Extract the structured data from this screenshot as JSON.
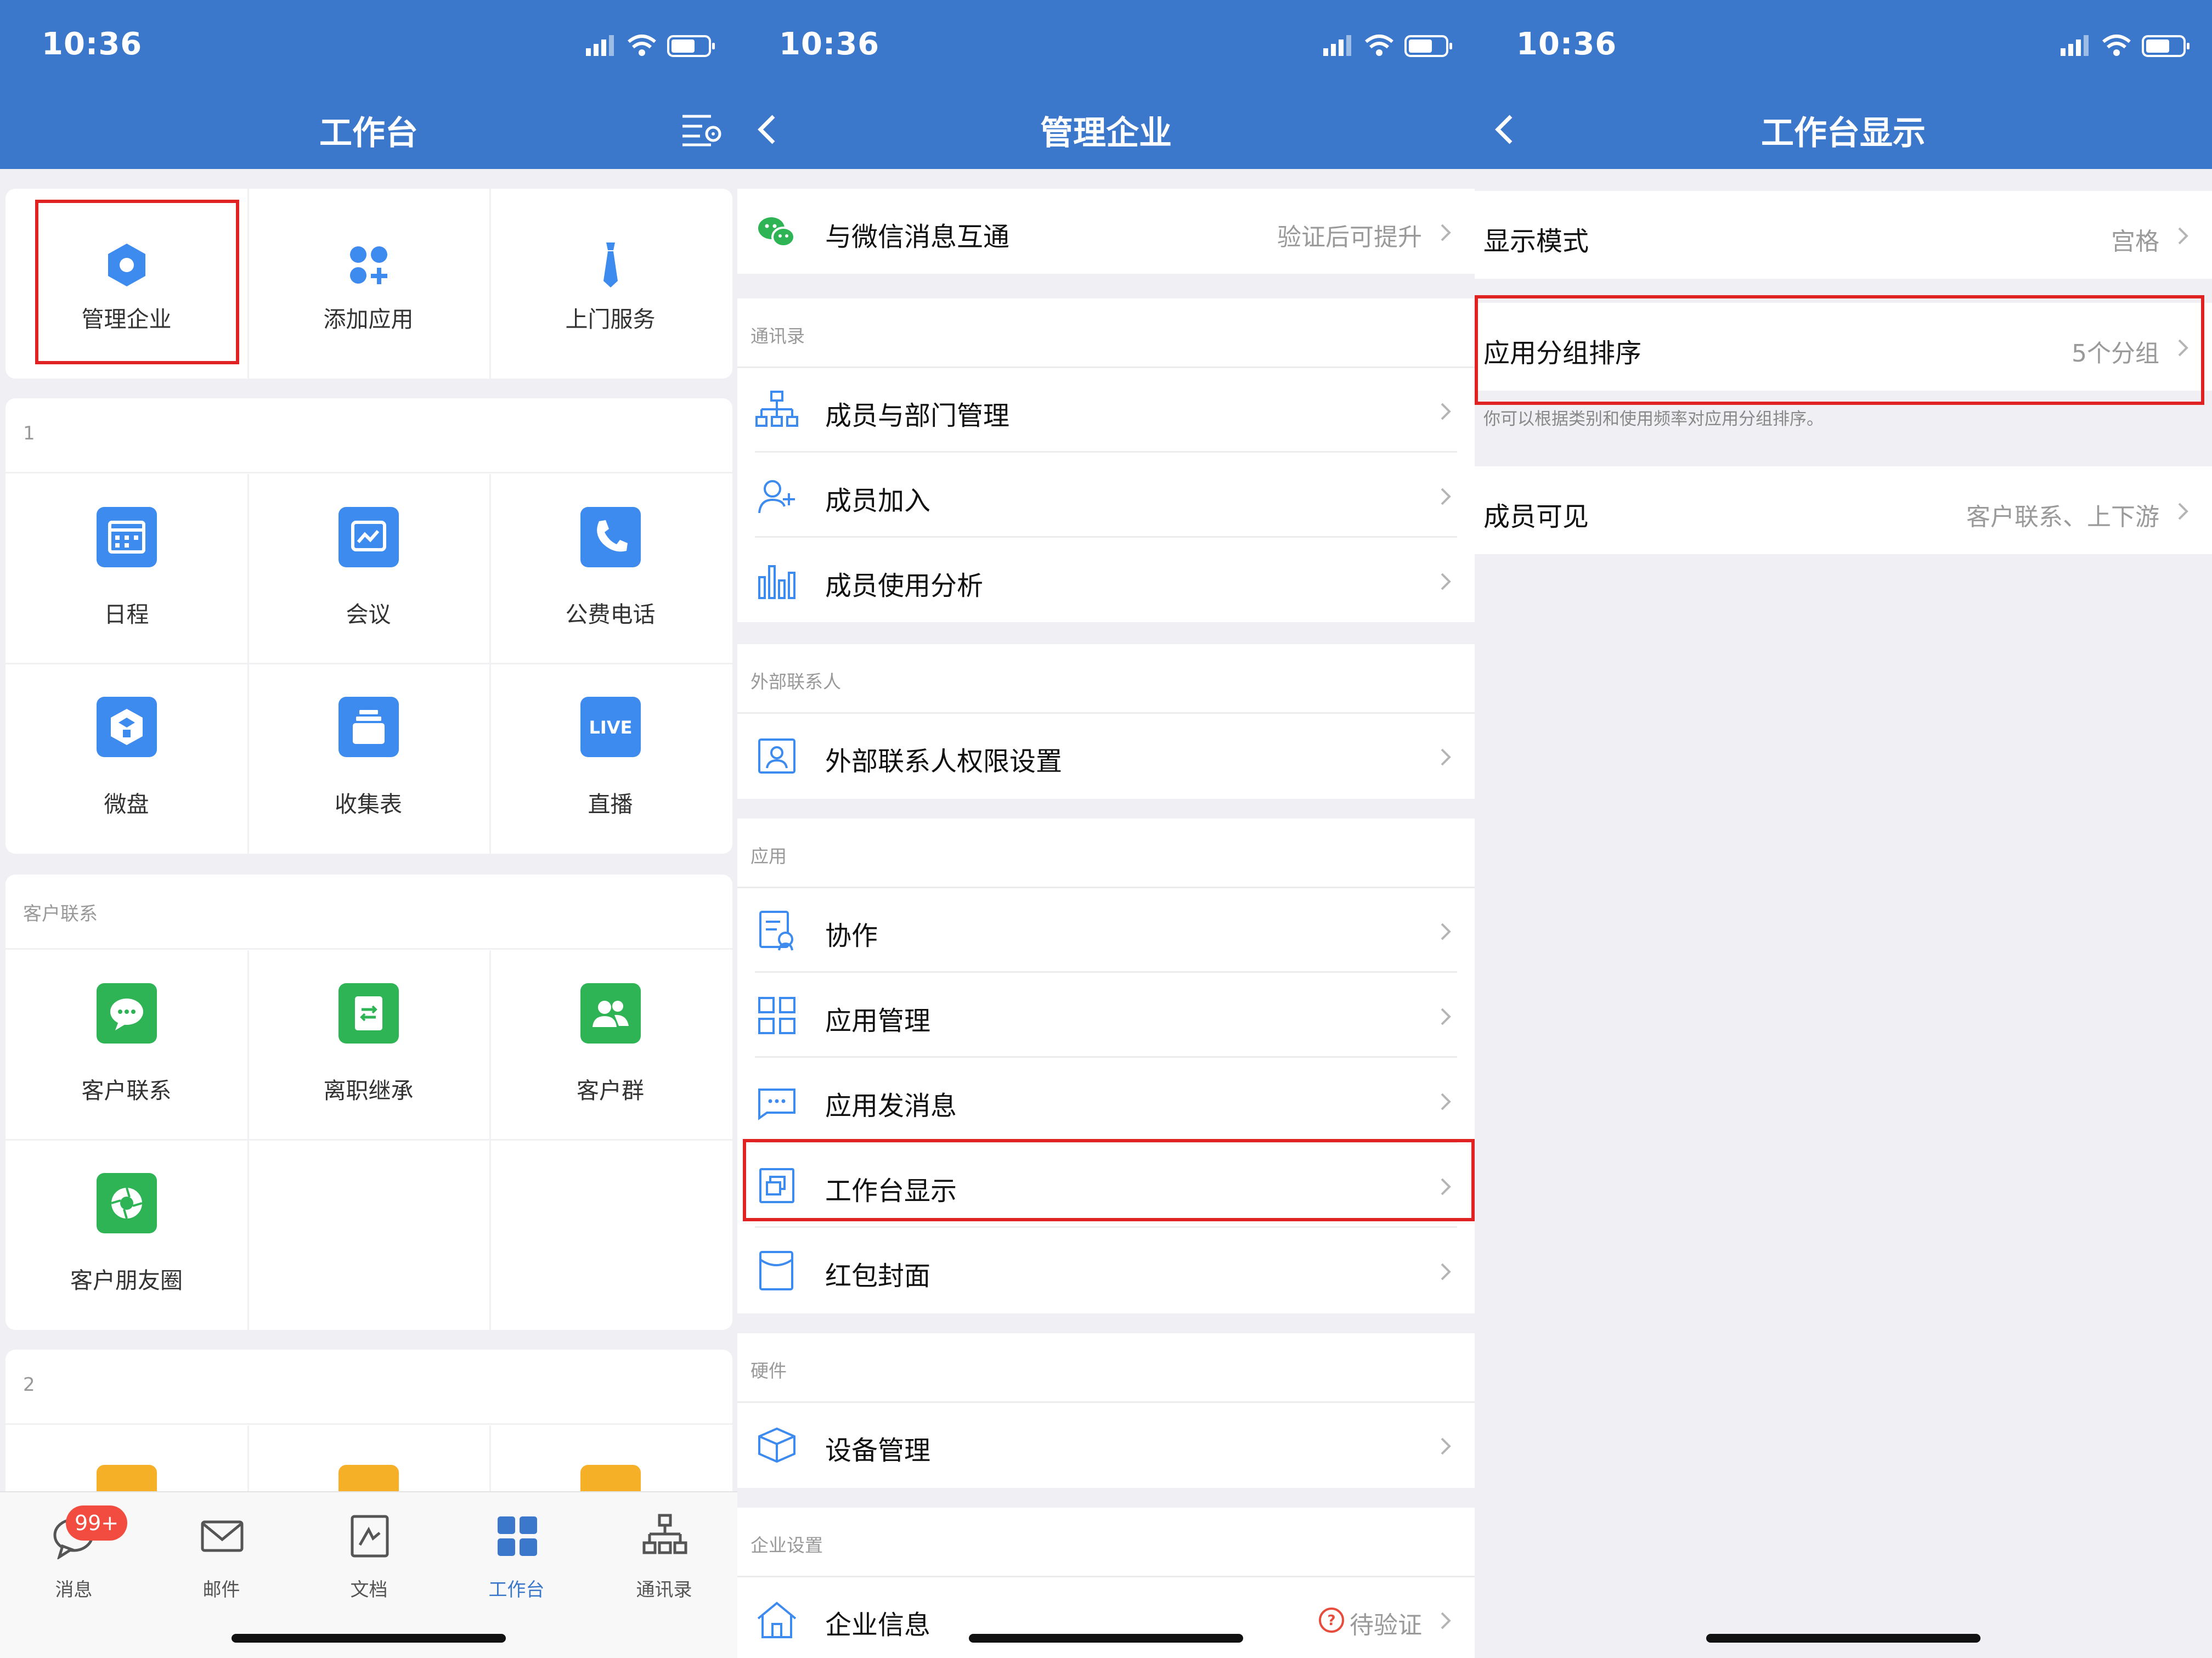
{
  "status": {
    "time": "10:36"
  },
  "workbench": {
    "title": "工作台",
    "top_apps": [
      "管理企业",
      "添加应用",
      "上门服务"
    ],
    "group1": {
      "title": "1",
      "apps": [
        "日程",
        "会议",
        "公费电话",
        "微盘",
        "收集表",
        "直播"
      ]
    },
    "group_customer": {
      "title": "客户联系",
      "apps": [
        "客户联系",
        "离职继承",
        "客户群",
        "客户朋友圈"
      ]
    },
    "group2": {
      "title": "2"
    },
    "live_icon_text": "LIVE",
    "tabs": [
      "消息",
      "邮件",
      "文档",
      "工作台",
      "通讯录"
    ],
    "message_badge": "99+",
    "colors": {
      "accent": "#3b78cc",
      "blue_icon": "#3e8bf0",
      "green_icon": "#2fb455",
      "orange_icon": "#f6b028",
      "highlight": "#e02222"
    }
  },
  "manage": {
    "title": "管理企业",
    "wechat": {
      "label": "与微信消息互通",
      "value": "验证后可提升"
    },
    "contacts": {
      "title": "通讯录",
      "items": [
        "成员与部门管理",
        "成员加入",
        "成员使用分析"
      ]
    },
    "external": {
      "title": "外部联系人",
      "items": [
        "外部联系人权限设置"
      ]
    },
    "apps": {
      "title": "应用",
      "items": [
        "协作",
        "应用管理",
        "应用发消息",
        "工作台显示",
        "红包封面"
      ]
    },
    "hardware": {
      "title": "硬件",
      "items": [
        "设备管理"
      ]
    },
    "corp": {
      "title": "企业设置",
      "items": [
        "企业信息"
      ],
      "value": "待验证"
    }
  },
  "display": {
    "title": "工作台显示",
    "mode": {
      "label": "显示模式",
      "value": "宫格"
    },
    "sort": {
      "label": "应用分组排序",
      "value": "5个分组",
      "hint": "你可以根据类别和使用频率对应用分组排序。"
    },
    "visible": {
      "label": "成员可见",
      "value": "客户联系、上下游"
    }
  }
}
